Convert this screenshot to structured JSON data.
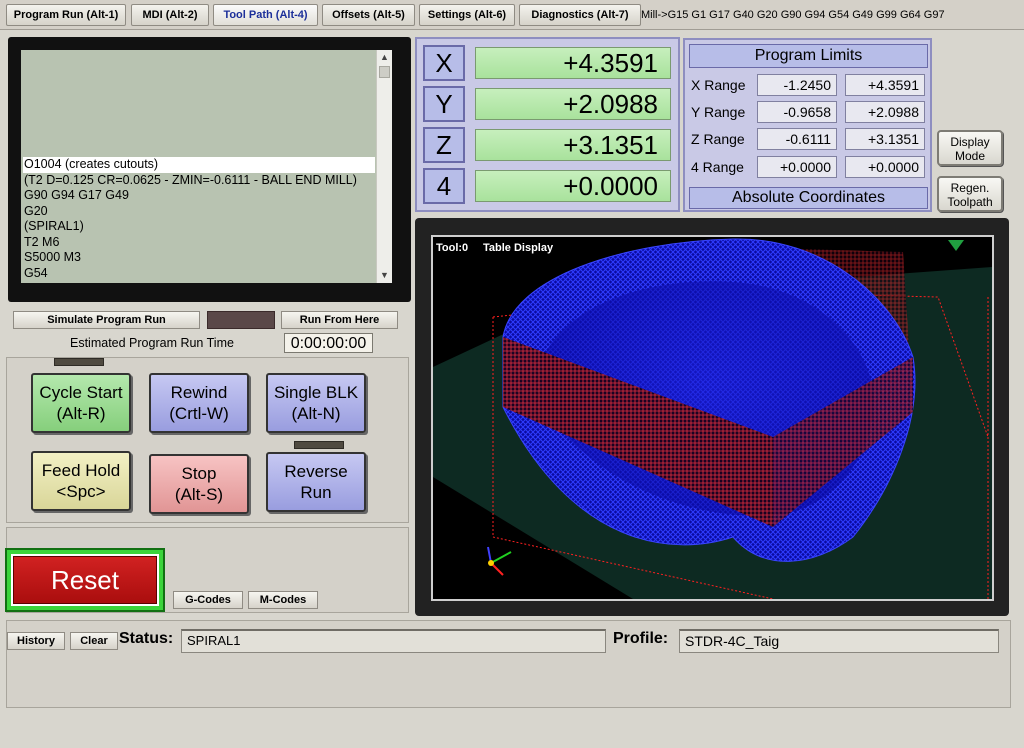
{
  "tabs": [
    {
      "label": "Program Run (Alt-1)"
    },
    {
      "label": "MDI (Alt-2)"
    },
    {
      "label": "Tool Path (Alt-4)"
    },
    {
      "label": "Offsets (Alt-5)"
    },
    {
      "label": "Settings (Alt-6)"
    },
    {
      "label": "Diagnostics (Alt-7)"
    }
  ],
  "active_tab": "Tool Path (Alt-4)",
  "modal_line": "Mill->G15  G1 G17 G40 G20 G90 G94 G54 G49 G99 G64 G97",
  "gcode": {
    "lines": [
      "O1004 (creates cutouts)",
      "(T2 D=0.125 CR=0.0625 - ZMIN=-0.6111 - BALL END MILL)",
      "G90 G94 G17 G49",
      "G20",
      "(SPIRAL1)",
      "T2 M6",
      "S5000 M3",
      "G54"
    ],
    "scroll_up": "▲",
    "scroll_down": "▼"
  },
  "dro": {
    "axes": [
      {
        "name": "X",
        "value": "+4.3591"
      },
      {
        "name": "Y",
        "value": "+2.0988"
      },
      {
        "name": "Z",
        "value": "+3.1351"
      },
      {
        "name": "4",
        "value": "+0.0000"
      }
    ]
  },
  "program_limits": {
    "title": "Program Limits",
    "rows": [
      {
        "label": "X Range",
        "min": "-1.2450",
        "max": "+4.3591"
      },
      {
        "label": "Y Range",
        "min": "-0.9658",
        "max": "+2.0988"
      },
      {
        "label": "Z Range",
        "min": "-0.6111",
        "max": "+3.1351"
      },
      {
        "label": "4 Range",
        "min": "+0.0000",
        "max": "+0.0000"
      }
    ],
    "coord_mode": "Absolute Coordinates"
  },
  "side_buttons": {
    "display_mode": [
      "Display",
      "Mode"
    ],
    "regen_toolpath": [
      "Regen.",
      "Toolpath"
    ]
  },
  "toolpath": {
    "tool_label": "Tool:0",
    "display_label": "Table Display",
    "colors": {
      "toolpath": "#1a1aff",
      "rapids": "#ff2020",
      "table": "#0d2a22"
    }
  },
  "simulate": {
    "simulate_label": "Simulate Program Run",
    "run_from_here_label": "Run From Here",
    "estimated_label": "Estimated Program Run Time",
    "estimated_value": "0:00:00:00"
  },
  "controls": {
    "cycle_start": [
      "Cycle Start",
      "(Alt-R)"
    ],
    "rewind": [
      "Rewind",
      "(Crtl-W)"
    ],
    "single_blk": [
      "Single BLK",
      "(Alt-N)"
    ],
    "feed_hold": [
      "Feed Hold",
      "<Spc>"
    ],
    "stop": [
      "Stop",
      "(Alt-S)"
    ],
    "reverse_run": [
      "Reverse",
      "Run"
    ]
  },
  "reset_label": "Reset",
  "gcodes_label": "G-Codes",
  "mcodes_label": "M-Codes",
  "status": {
    "history_label": "History",
    "clear_label": "Clear",
    "status_label": "Status:",
    "status_value": "SPIRAL1",
    "profile_label": "Profile:",
    "profile_value": "STDR-4C_Taig"
  }
}
